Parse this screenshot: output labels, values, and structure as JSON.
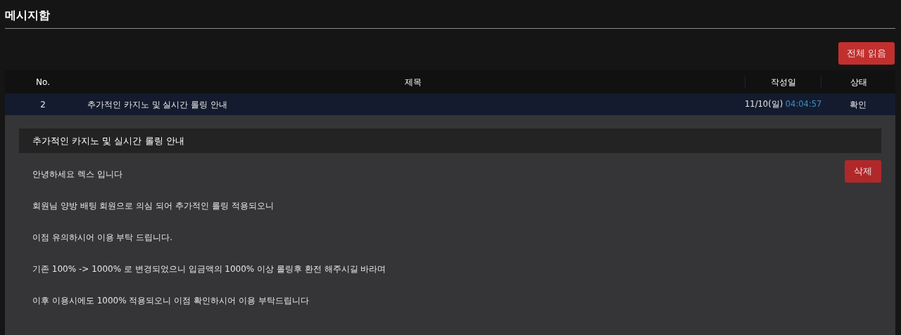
{
  "page_title": "메시지함",
  "read_all_button": "전체 읽음",
  "table": {
    "columns": [
      "No.",
      "제목",
      "작성일",
      "상태"
    ],
    "rows": [
      {
        "no": "2",
        "title": "추가적인 카지노 및 실시간 롤링 안내",
        "date": "11/10(일)",
        "time": "04:04:57",
        "status": "확인",
        "expanded": true,
        "detail": {
          "title": "추가적인 카지노 및 실시간 롤링 안내",
          "delete_button": "삭제",
          "paragraphs": [
            "안녕하세요 렉스 입니다",
            "회원님 양방 배팅 회원으로 의심 되어 추가적인 롤링 적용되오니",
            "이점 유의하시어 이용 부탁 드립니다.",
            "기존 100% -> 1000% 로 변경되었으니 입금액의 1000% 이상 롤링후 환전 해주시길 바라며",
            "이후 이용시에도 1000% 적용되오니 이점 확인하시어 이용 부탁드립니다"
          ]
        }
      }
    ]
  }
}
